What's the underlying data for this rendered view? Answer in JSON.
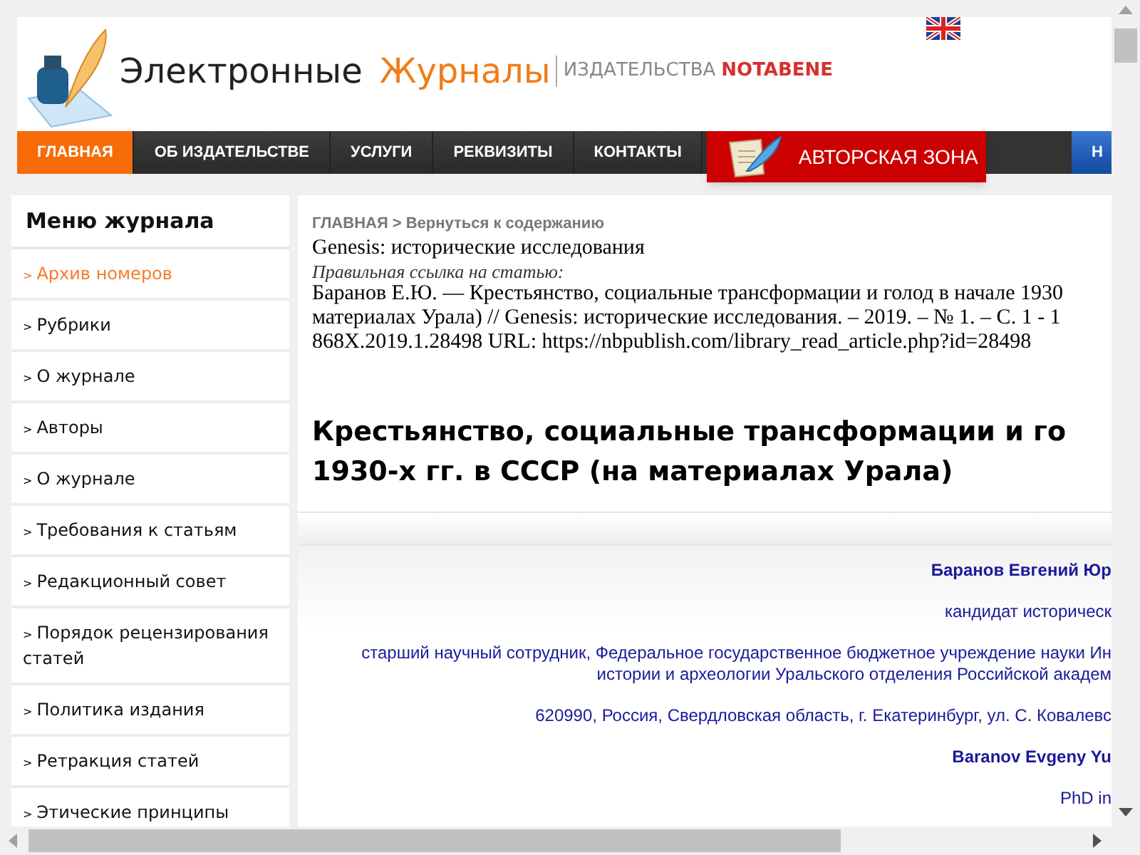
{
  "header": {
    "logo": {
      "word_1": "Электронные",
      "word_2": "Журналы",
      "publisher_label": "ИЗДАТЕЛЬСТВА",
      "publisher_name": "NOTABENE"
    }
  },
  "nav": [
    {
      "label": "ГЛАВНАЯ",
      "kind": "plain",
      "selected": true
    },
    {
      "label": "ОБ ИЗДАТЕЛЬСТВЕ",
      "kind": "plain",
      "selected": false
    },
    {
      "label": "УСЛУГИ",
      "kind": "plain",
      "selected": false
    },
    {
      "label": "РЕКВИЗИТЫ",
      "kind": "plain",
      "selected": false
    },
    {
      "label": "КОНТАКТЫ",
      "kind": "plain",
      "selected": false
    },
    {
      "label": "АВТОРСКАЯ ЗОНА",
      "kind": "author",
      "selected": false
    },
    {
      "label": "Н",
      "kind": "blue",
      "selected": false
    }
  ],
  "sidebar": {
    "title": "Меню журнала",
    "bullet": ">",
    "items": [
      {
        "label": "Архив номеров",
        "selected": true
      },
      {
        "label": "Рубрики",
        "selected": false
      },
      {
        "label": "О журнале",
        "selected": false
      },
      {
        "label": "Авторы",
        "selected": false
      },
      {
        "label": "О журнале",
        "selected": false
      },
      {
        "label": "Требования к статьям",
        "selected": false
      },
      {
        "label": "Редакционный совет",
        "selected": false
      },
      {
        "label": "Порядок рецензирования статей",
        "selected": false
      },
      {
        "label": "Политика издания",
        "selected": false
      },
      {
        "label": "Ретракция статей",
        "selected": false
      },
      {
        "label": "Этические принципы",
        "selected": false
      }
    ]
  },
  "breadcrumb": {
    "items": [
      "ГЛАВНАЯ",
      "Вернуться к содержанию"
    ],
    "separator": ">"
  },
  "journal": "Genesis: исторические исследования",
  "citation_label": "Правильная ссылка на статью:",
  "citation_lines": [
    "Баранов Е.Ю. — Крестьянство, социальные трансформации и голод в начале 1930",
    "материалах Урала) // Genesis: исторические исследования. – 2019. – № 1. – С. 1 - 1",
    "868X.2019.1.28498 URL: https://nbpublish.com/library_read_article.php?id=28498"
  ],
  "article_title_lines": [
    "Крестьянство, социальные трансформации и го",
    "1930-х гг. в СССР (на материалах Урала)"
  ],
  "author_info": [
    {
      "kind": "name",
      "lines": [
        "Баранов Евгений Юр"
      ]
    },
    {
      "kind": "text",
      "lines": [
        "кандидат историческ"
      ]
    },
    {
      "kind": "text",
      "lines": [
        "старший научный сотрудник, Федеральное государственное бюджетное учреждение науки Ин",
        "истории и археологии Уральского отделения Российской академ"
      ]
    },
    {
      "kind": "text",
      "lines": [
        "620990, Россия, Свердловская область, г. Екатеринбург, ул. С. Ковалевс"
      ]
    },
    {
      "kind": "name",
      "lines": [
        "Baranov Evgeny Yu"
      ]
    },
    {
      "kind": "text",
      "lines": [
        "PhD in"
      ]
    }
  ]
}
